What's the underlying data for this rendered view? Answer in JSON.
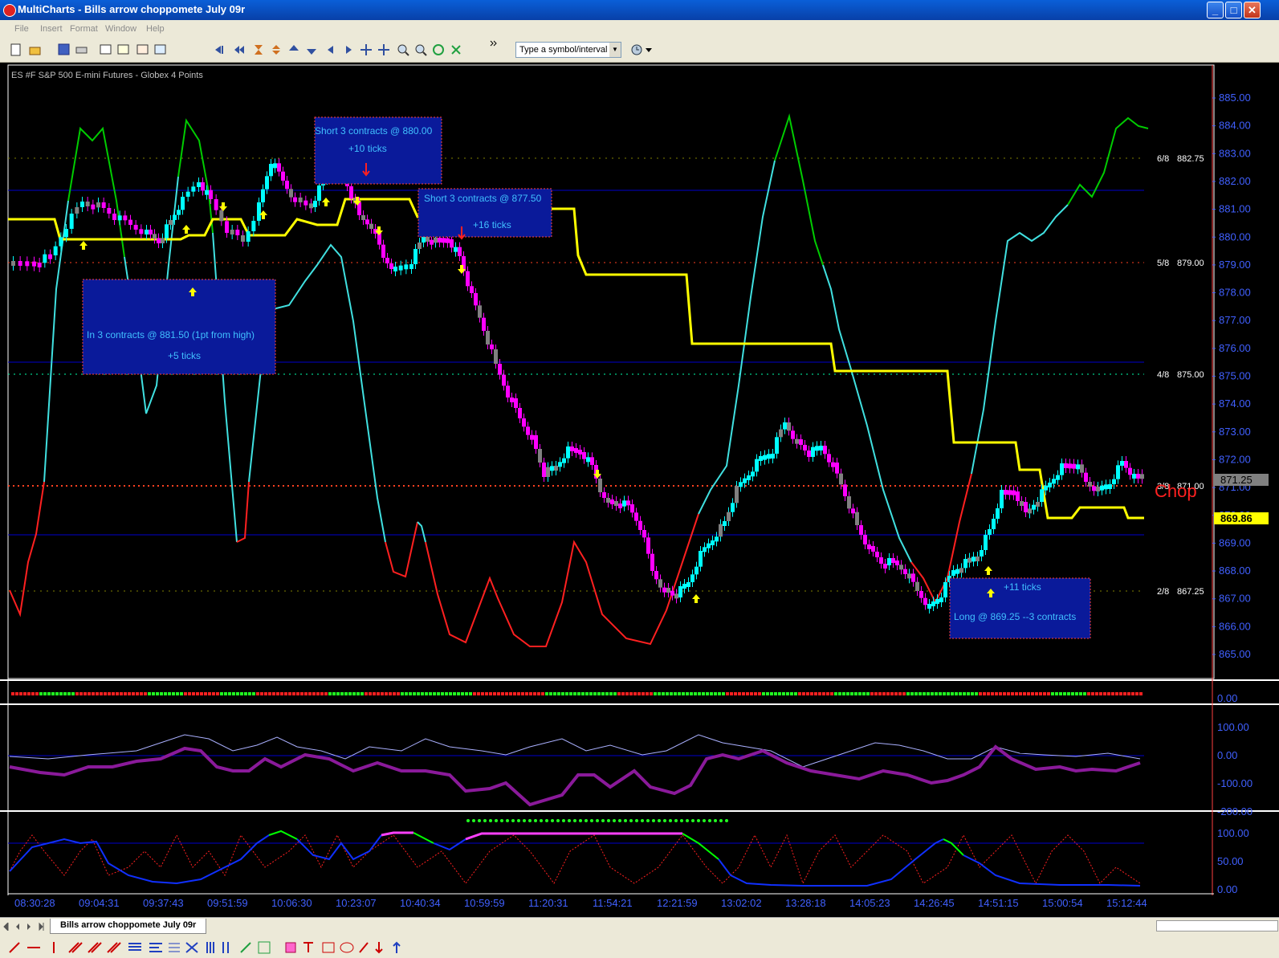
{
  "window": {
    "title": "MultiCharts - Bills arrow choppomete July 09r",
    "controls": [
      "_",
      "□",
      "✕"
    ]
  },
  "menu": [
    "File",
    "Insert",
    "Format",
    "Window",
    "Help"
  ],
  "toolbar": {
    "symbol_placeholder": "Type a symbol/interval"
  },
  "chart": {
    "header": "ES #F   S&P 500 E-mini Futures - Globex  4 Points",
    "price_axis": [
      "885.00",
      "884.00",
      "883.00",
      "882.00",
      "881.00",
      "880.00",
      "879.00",
      "878.00",
      "877.00",
      "876.00",
      "875.00",
      "874.00",
      "873.00",
      "872.00",
      "871.00",
      "870.00",
      "869.00",
      "868.00",
      "867.00",
      "866.00",
      "865.00"
    ],
    "current_price": "871.25",
    "yellow_value": "869.86",
    "levels": [
      {
        "frac": "6/8",
        "price": "882.75"
      },
      {
        "frac": "5/8",
        "price": "879.00"
      },
      {
        "frac": "4/8",
        "price": "875.00"
      },
      {
        "frac": "3/8",
        "price": "871.00"
      },
      {
        "frac": "2/8",
        "price": "867.25"
      }
    ],
    "chop_label": "Chop",
    "annotations": [
      {
        "line1": "Short 3 contracts @ 880.00",
        "line2": "+10  ticks"
      },
      {
        "line1": "Short 3 contracts @ 877.50",
        "line2": "+16 ticks"
      },
      {
        "line1": "In  3 contracts @ 881.50 (1pt from high)",
        "line2": "+5 ticks"
      },
      {
        "line1": "+11 ticks",
        "line2": "Long @ 869.25 --3 contracts"
      }
    ],
    "panel2_axis": [
      "0.00"
    ],
    "panel3_axis": [
      "100.00",
      "0.00",
      "-100.00",
      "-200.00"
    ],
    "panel4_axis": [
      "100.00",
      "50.00",
      "0.00"
    ],
    "time_axis": [
      "08:30:28",
      "09:04:31",
      "09:37:43",
      "09:51:59",
      "10:06:30",
      "10:23:07",
      "10:40:34",
      "10:59:59",
      "11:20:31",
      "11:54:21",
      "12:21:59",
      "13:02:02",
      "13:28:18",
      "14:05:23",
      "14:26:45",
      "14:51:15",
      "15:00:54",
      "15:12:44"
    ]
  },
  "tabs": {
    "active": "Bills arrow choppomete July 09r"
  },
  "colors": {
    "bull": "#00ffff",
    "bear": "#ff00ff",
    "neutral": "#808080",
    "stop_line": "#ffff00",
    "up_osc": "#00cc00",
    "down_osc": "#ff0000",
    "osc_mid": "#40e0e0"
  }
}
